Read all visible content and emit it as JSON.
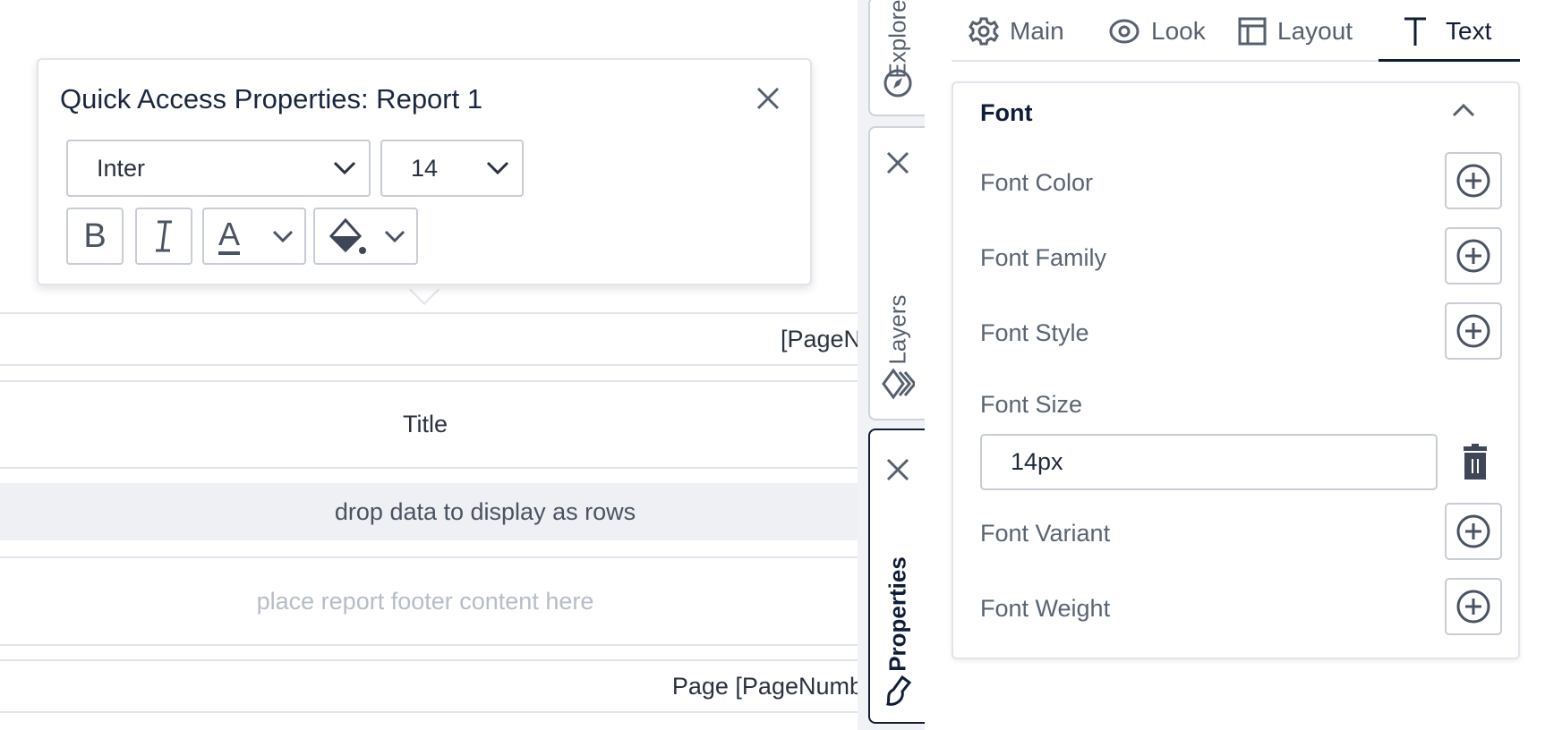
{
  "popup": {
    "title": "Quick Access Properties: Report 1",
    "font_family": "Inter",
    "font_size": "14",
    "bold_label": "B",
    "italic_label": "I",
    "font_color_label": "A"
  },
  "canvas": {
    "page_header": "[PageN",
    "title": "Title",
    "rows_placeholder": "drop data to display as rows",
    "footer_placeholder": "place report footer content here",
    "page_footer": "Page [PageNumb"
  },
  "side_tabs": {
    "explore": "Explore",
    "layers": "Layers",
    "properties": "Properties"
  },
  "tabs": [
    {
      "label": "Main",
      "icon": "gear-icon"
    },
    {
      "label": "Look",
      "icon": "eye-icon"
    },
    {
      "label": "Layout",
      "icon": "layout-icon"
    },
    {
      "label": "Text",
      "icon": "text-icon",
      "active": true
    }
  ],
  "section": {
    "title": "Font",
    "items": [
      {
        "label": "Font Color"
      },
      {
        "label": "Font Family"
      },
      {
        "label": "Font Style"
      },
      {
        "label": "Font Size",
        "value": "14px"
      },
      {
        "label": "Font Variant"
      },
      {
        "label": "Font Weight"
      }
    ]
  },
  "colors": {
    "accent": "#0f1d3a",
    "icon": "#56606f",
    "border": "#c7ccd6",
    "band_gray": "#eef0f3"
  }
}
